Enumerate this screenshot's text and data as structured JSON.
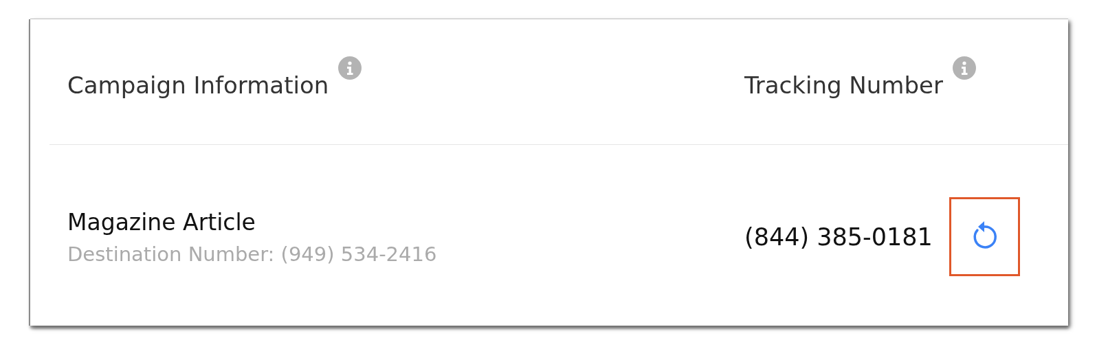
{
  "table": {
    "columns": [
      {
        "label": "Campaign Information",
        "info": true
      },
      {
        "label": "Tracking Number",
        "info": true
      }
    ],
    "rows": [
      {
        "campaign": "Magazine Article",
        "destination": "Destination Number: (949) 534-2416",
        "tracking_number": "(844) 385-0181",
        "highlighted": true
      }
    ]
  }
}
